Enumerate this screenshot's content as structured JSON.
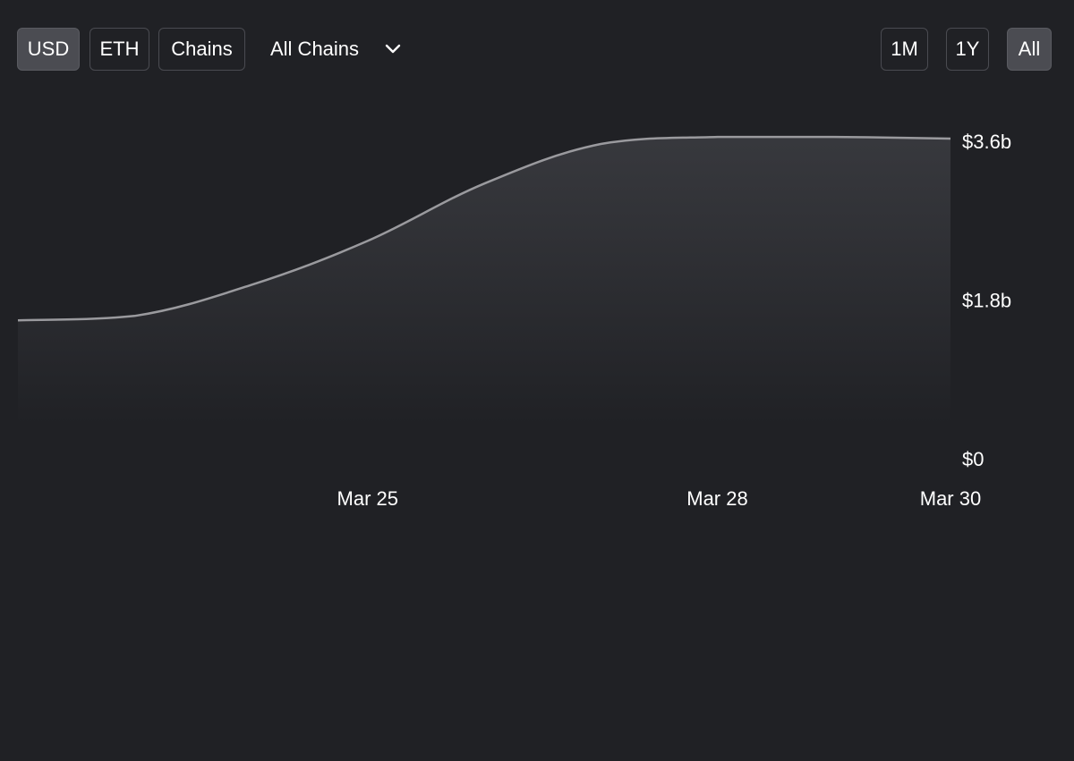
{
  "toolbar": {
    "currency_buttons": [
      "USD",
      "ETH",
      "Chains"
    ],
    "active_currency": "USD",
    "chain_select": "All Chains",
    "range_buttons": [
      "1M",
      "1Y",
      "All"
    ],
    "active_range": "All",
    "icons": {
      "chain_select": "chevron-down-icon"
    }
  },
  "chart_data": {
    "type": "area",
    "x_labels": [
      "Mar 25",
      "Mar 28",
      "Mar 30"
    ],
    "y_ticks": [
      "$0",
      "$1.8b",
      "$3.6b"
    ],
    "ylim": [
      0,
      3.6
    ],
    "unit": "billion USD",
    "xlim": [
      "Mar 22",
      "Mar 30"
    ],
    "series": [
      {
        "x": [
          "Mar 22",
          "Mar 23",
          "Mar 24",
          "Mar 25",
          "Mar 26",
          "Mar 27",
          "Mar 28",
          "Mar 29",
          "Mar 30"
        ],
        "values": [
          1.57,
          1.62,
          1.97,
          2.47,
          3.12,
          3.57,
          3.65,
          3.65,
          3.63
        ]
      }
    ],
    "grid": false,
    "colors": {
      "line": "#9a9a9e",
      "background": "#202125",
      "text": "#ffffff"
    }
  }
}
